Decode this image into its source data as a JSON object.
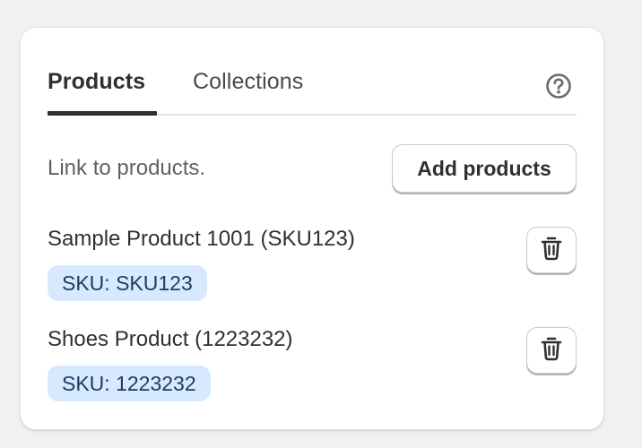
{
  "tabs": [
    {
      "label": "Products",
      "active": true
    },
    {
      "label": "Collections",
      "active": false
    }
  ],
  "help_icon": "question-circle-icon",
  "description": "Link to products.",
  "add_button_label": "Add products",
  "products": [
    {
      "name": "Sample Product 1001 (SKU123)",
      "sku_badge": "SKU: SKU123",
      "delete_icon": "trash-icon"
    },
    {
      "name": "Shoes Product (1223232)",
      "sku_badge": "SKU: 1223232",
      "delete_icon": "trash-icon"
    }
  ],
  "colors": {
    "page_bg": "#f1f1f1",
    "card_bg": "#ffffff",
    "text": "#303030",
    "muted_text": "#616161",
    "badge_bg": "#d6e9fe",
    "badge_text": "#1c3b5e",
    "tab_underline": "#303030"
  }
}
